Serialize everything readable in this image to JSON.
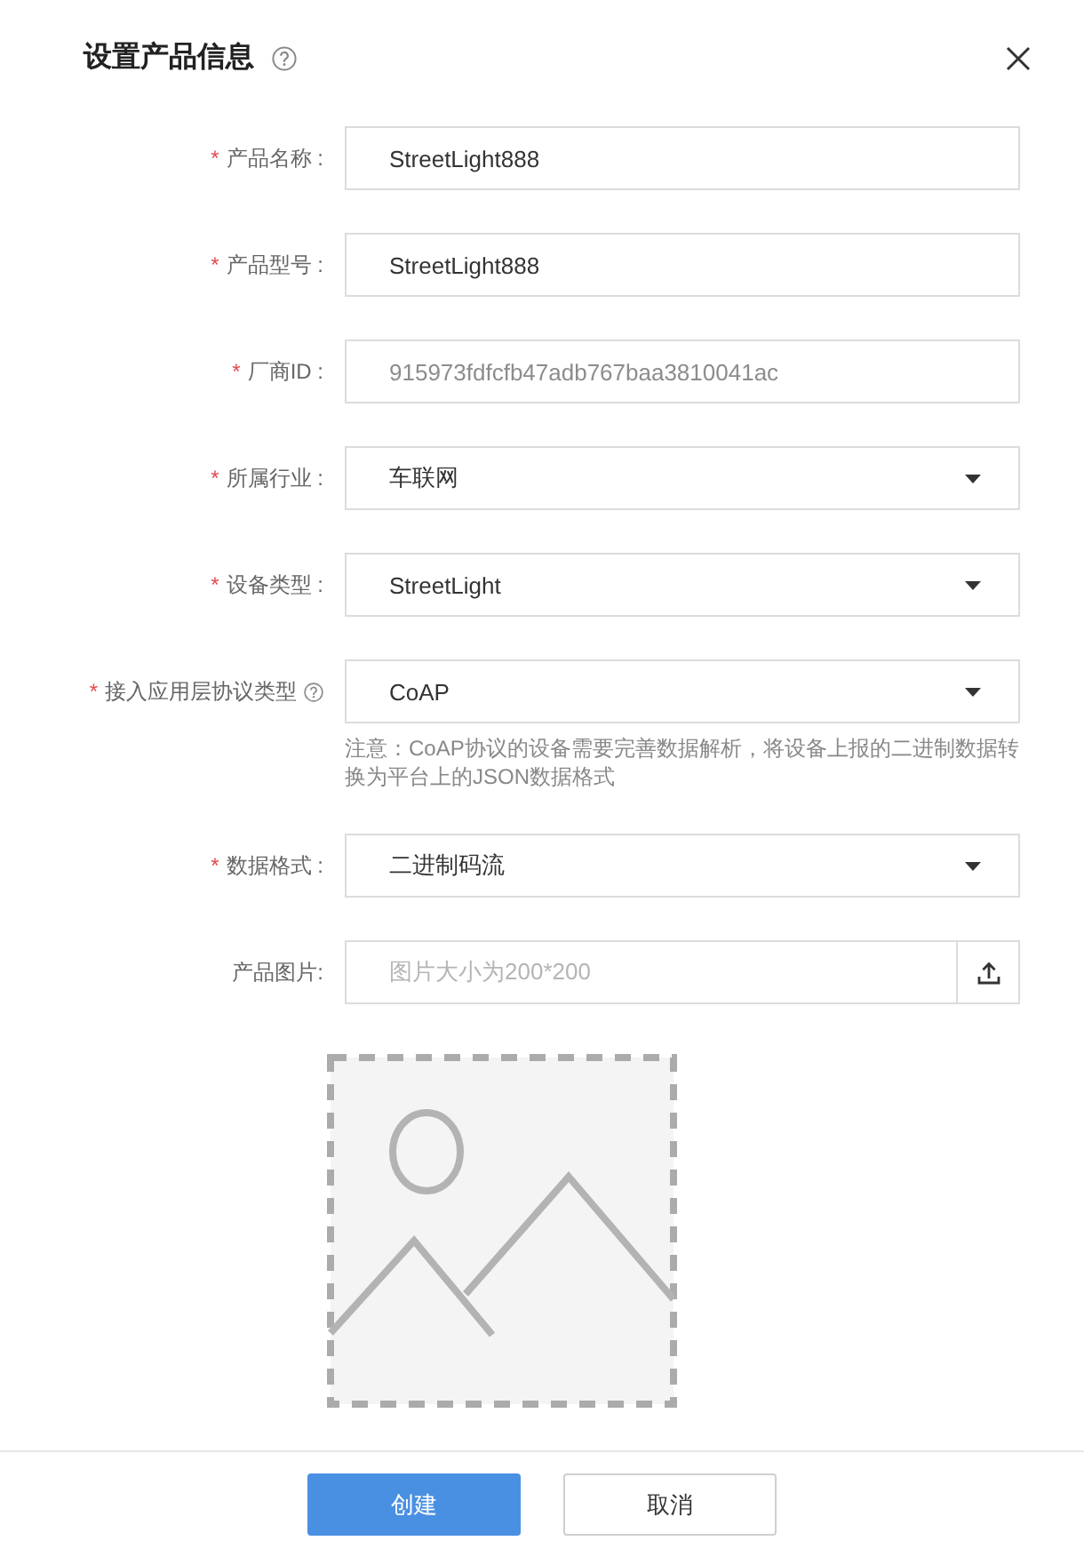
{
  "dialog": {
    "title": "设置产品信息"
  },
  "fields": [
    {
      "kind": "text",
      "required_mark": "*",
      "label": "产品名称 :",
      "help": false,
      "value": "StreetLight888",
      "disabled": false
    },
    {
      "kind": "text",
      "required_mark": "*",
      "label": "产品型号 :",
      "help": false,
      "value": "StreetLight888",
      "disabled": false
    },
    {
      "kind": "text",
      "required_mark": "*",
      "label": "厂商ID :",
      "help": false,
      "value": "915973fdfcfb47adb767baa3810041ac",
      "disabled": true
    },
    {
      "kind": "select",
      "required_mark": "*",
      "label": "所属行业 :",
      "help": false,
      "value": "车联网",
      "disabled": false
    },
    {
      "kind": "select",
      "required_mark": "*",
      "label": "设备类型 :",
      "help": false,
      "value": "StreetLight",
      "disabled": false
    },
    {
      "kind": "select",
      "required_mark": "*",
      "label": "接入应用层协议类型",
      "help": true,
      "value": "CoAP",
      "disabled": false,
      "note": "注意：CoAP协议的设备需要完善数据解析，将设备上报的二进制数据转换为平台上的JSON数据格式"
    },
    {
      "kind": "select",
      "required_mark": "*",
      "label": "数据格式 :",
      "help": false,
      "value": "二进制码流",
      "disabled": false
    },
    {
      "kind": "upload",
      "label": "产品图片:",
      "help": false,
      "placeholder": "图片大小为200*200",
      "disabled": false
    }
  ],
  "buttons": [
    {
      "kind": "primary",
      "label": "创建"
    },
    {
      "kind": "default",
      "label": "取消"
    }
  ]
}
